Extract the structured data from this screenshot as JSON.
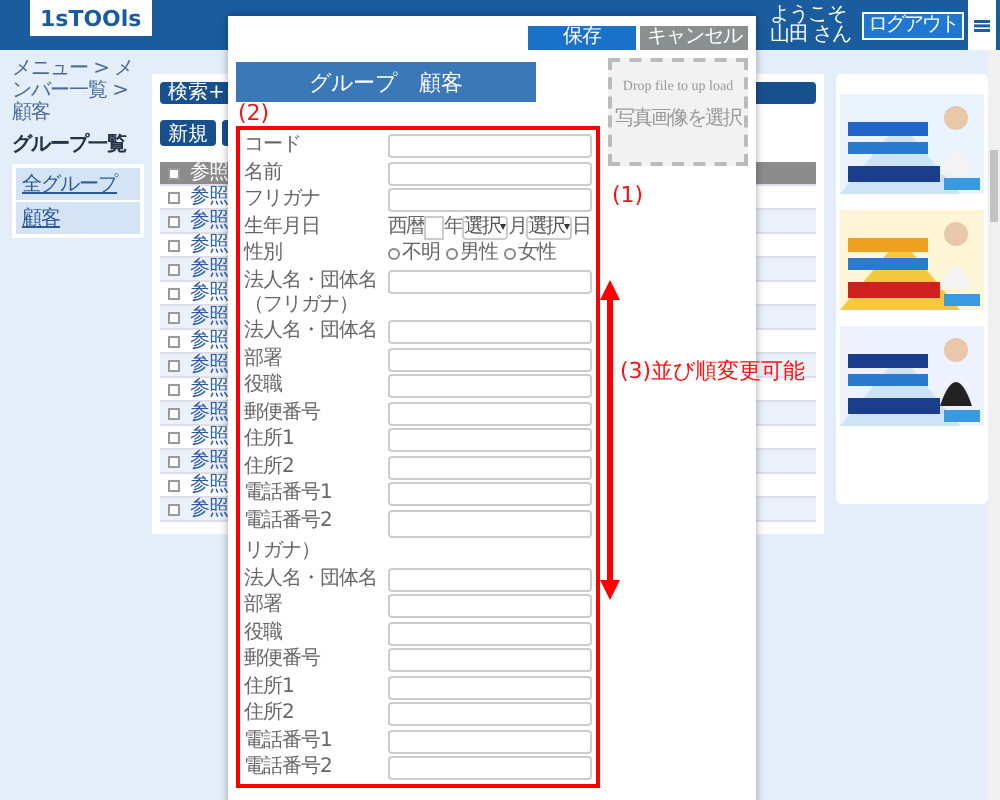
{
  "header": {
    "logo": "1sTOOls",
    "welcome": "ようこそ山田 さん",
    "logout": "ログアウト"
  },
  "breadcrumb": "メニュー > メンバー一覧 > 顧客",
  "sidebar": {
    "title": "グループ一覧",
    "items": [
      "全グループ",
      "顧客"
    ]
  },
  "main": {
    "search_label": "検索+",
    "buttons": [
      "新規"
    ],
    "table": {
      "header": {
        "label": "参照",
        "checked": false
      },
      "rows": [
        {
          "link": "参照",
          "checked": false
        },
        {
          "link": "参照",
          "checked": false
        },
        {
          "link": "参照",
          "checked": false
        },
        {
          "link": "参照",
          "checked": false
        },
        {
          "link": "参照",
          "checked": false
        },
        {
          "link": "参照",
          "checked": false
        },
        {
          "link": "参照",
          "checked": false
        },
        {
          "link": "参照",
          "checked": false
        },
        {
          "link": "参照",
          "checked": false
        },
        {
          "link": "参照",
          "checked": false
        },
        {
          "link": "参照",
          "checked": false
        },
        {
          "link": "参照",
          "checked": false
        },
        {
          "link": "参照",
          "checked": false
        },
        {
          "link": "参照",
          "checked": false
        }
      ]
    }
  },
  "modal": {
    "buttons": [
      {
        "label": "保存",
        "kind": "primary"
      },
      {
        "label": "キャンセル",
        "kind": "secondary"
      }
    ],
    "title": "グループ　顧客",
    "dropzone": {
      "title": "Drop file to up load",
      "link": "写真画像を選択"
    },
    "fields": [
      {
        "kind": "text",
        "label": "コード"
      },
      {
        "kind": "text",
        "label": "名前"
      },
      {
        "kind": "text",
        "label": "フリガナ"
      },
      {
        "kind": "date",
        "label": "生年月日",
        "era": "西暦",
        "units": [
          "年",
          "月",
          "日"
        ],
        "selects": [
          "選択",
          "選択"
        ]
      },
      {
        "kind": "radio",
        "label": "性別",
        "options": [
          {
            "label": "不明",
            "selected": false
          },
          {
            "label": "男性",
            "selected": false
          },
          {
            "label": "女性",
            "selected": false
          }
        ]
      },
      {
        "kind": "text",
        "label": "法人名・団体名（フリガナ）"
      },
      {
        "kind": "text",
        "label": "法人名・団体名"
      },
      {
        "kind": "text",
        "label": "部署"
      },
      {
        "kind": "text",
        "label": "役職"
      },
      {
        "kind": "text",
        "label": "郵便番号"
      },
      {
        "kind": "text",
        "label": "住所1"
      },
      {
        "kind": "text",
        "label": "住所2"
      },
      {
        "kind": "text",
        "label": "電話番号1"
      },
      {
        "kind": "textarea",
        "label": "電話番号2"
      },
      {
        "kind": "note",
        "label": "リガナ）"
      },
      {
        "kind": "text",
        "label": "法人名・団体名"
      },
      {
        "kind": "text",
        "label": "部署"
      },
      {
        "kind": "text",
        "label": "役職"
      },
      {
        "kind": "text",
        "label": "郵便番号"
      },
      {
        "kind": "text",
        "label": "住所1"
      },
      {
        "kind": "text",
        "label": "住所2"
      },
      {
        "kind": "text",
        "label": "電話番号1"
      },
      {
        "kind": "text",
        "label": "電話番号2"
      }
    ]
  },
  "annotations": {
    "one": "(1)",
    "two": "(2)",
    "three": "(3)並び順変更可能"
  }
}
